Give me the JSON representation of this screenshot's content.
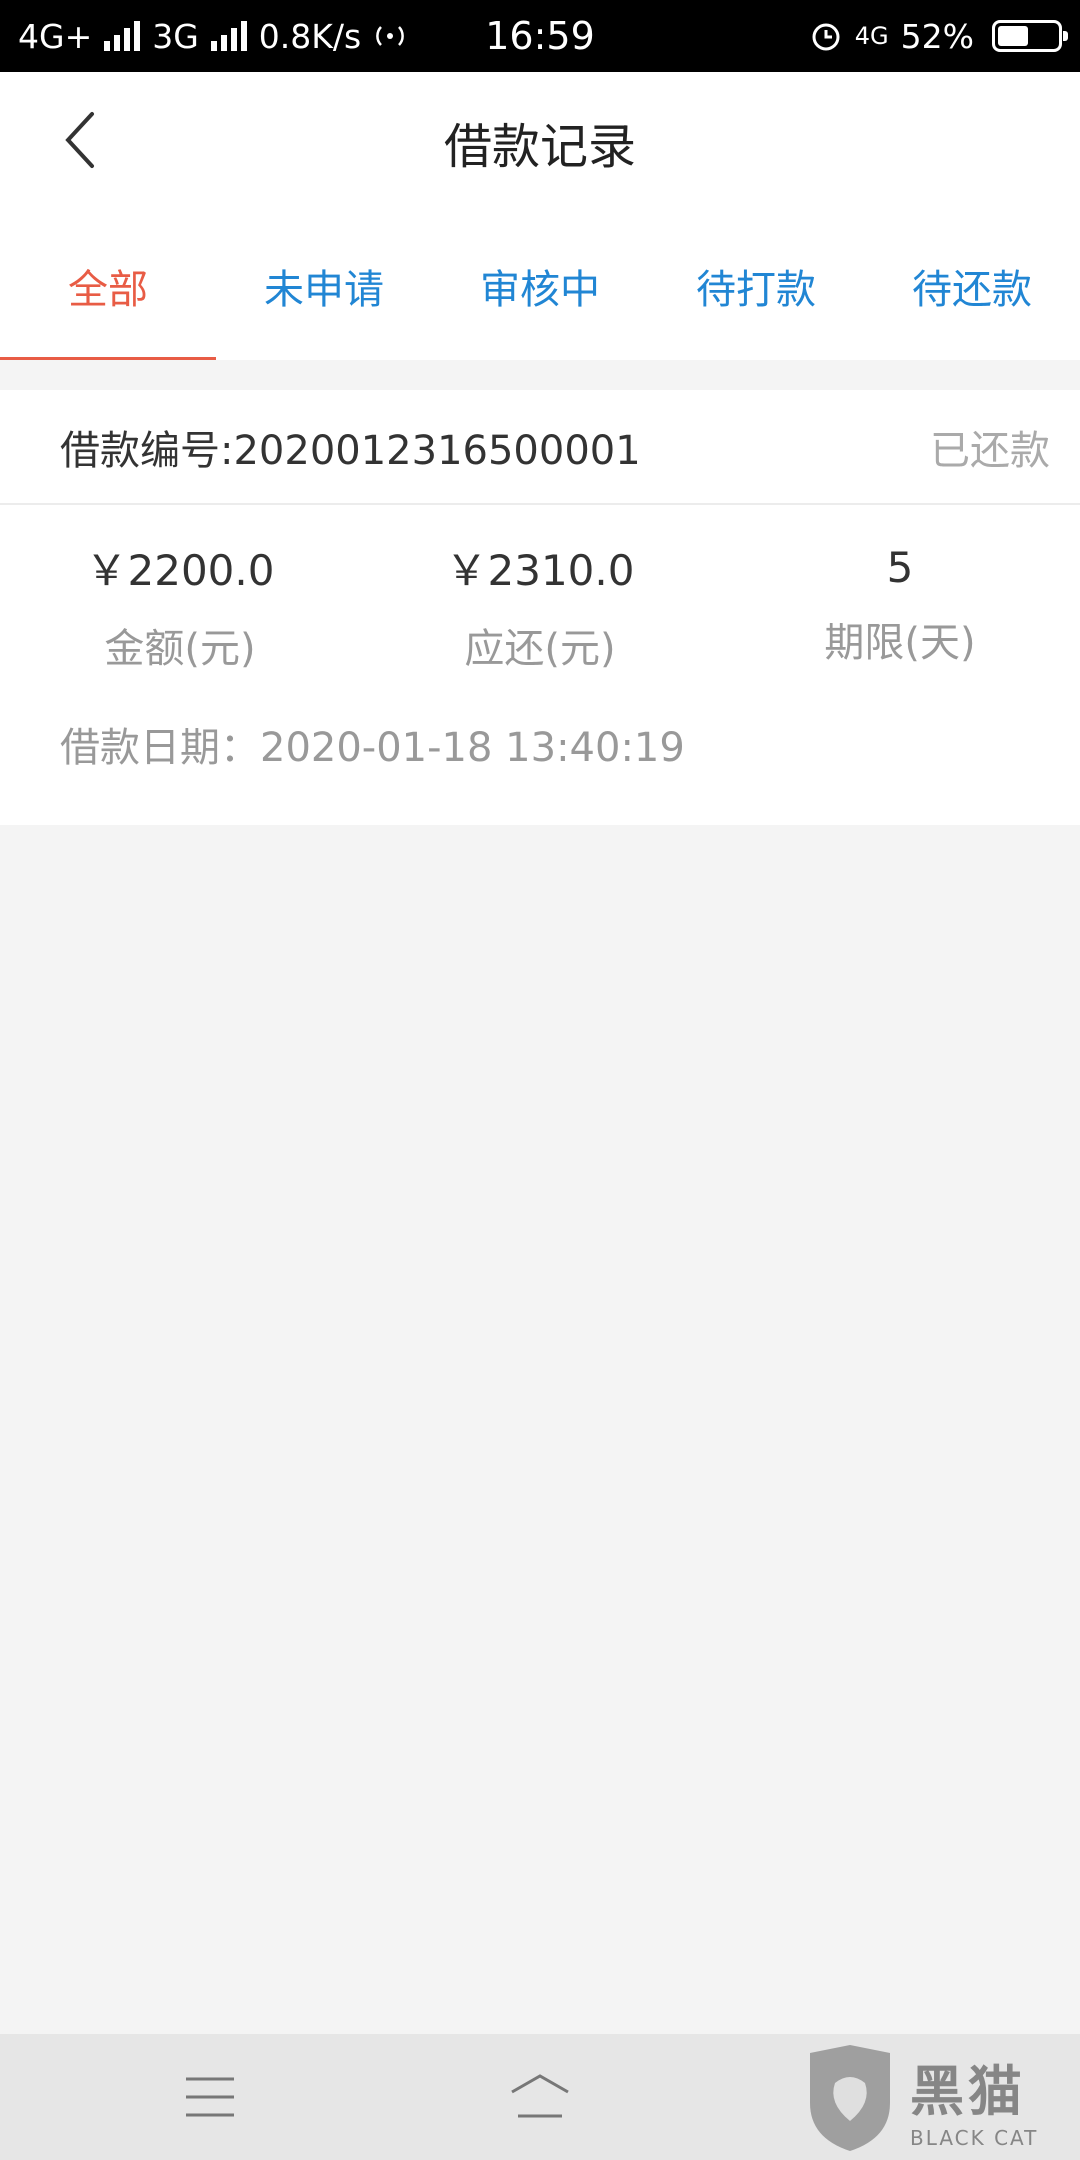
{
  "status_bar": {
    "network1": "4G+",
    "network2": "3G",
    "speed": "0.8K/s",
    "time": "16:59",
    "network3": "4G",
    "battery_text": "52%",
    "battery_level": 0.52
  },
  "header": {
    "title": "借款记录"
  },
  "tabs": [
    {
      "label": "全部",
      "active": true
    },
    {
      "label": "未申请",
      "active": false
    },
    {
      "label": "审核中",
      "active": false
    },
    {
      "label": "待打款",
      "active": false
    },
    {
      "label": "待还款",
      "active": false
    }
  ],
  "loan": {
    "number": "借款编号:2020012316500001",
    "status": "已还款",
    "amount_value": "￥2200.0",
    "amount_label": "金额(元)",
    "repay_value": "￥2310.0",
    "repay_label": "应还(元)",
    "term_value": "5",
    "term_label": "期限(天)",
    "date": "借款日期：2020-01-18 13:40:19"
  },
  "watermark": {
    "cn": "黑猫",
    "en": "BLACK CAT"
  },
  "colors": {
    "accent_active": "#e85c45",
    "tab_inactive": "#2186d4"
  }
}
